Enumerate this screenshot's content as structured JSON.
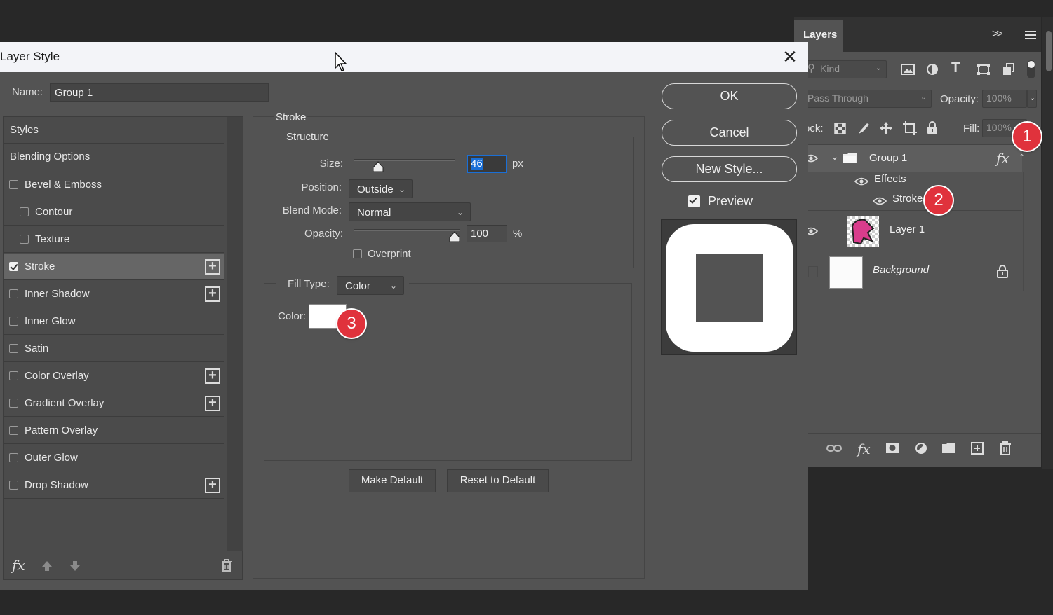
{
  "layers_panel": {
    "tab_label": "Layers",
    "expand_glyph": ">>",
    "filter_placeholder": "Kind",
    "blend_mode": "Pass Through",
    "opacity_label": "Opacity:",
    "opacity_value": "100%",
    "lock_label": "ock:",
    "fill_label": "Fill:",
    "fill_value": "100%",
    "layers": [
      {
        "name": "Group 1",
        "fx": "fx"
      },
      {
        "name": "Effects"
      },
      {
        "name": "Stroke"
      },
      {
        "name": "Layer 1"
      },
      {
        "name": "Background"
      }
    ]
  },
  "dialog": {
    "title": "Layer Style",
    "name_label": "Name:",
    "name_value": "Group 1",
    "styles": [
      {
        "label": "Styles",
        "checkbox": false,
        "plus": false
      },
      {
        "label": "Blending Options",
        "checkbox": false,
        "plus": false
      },
      {
        "label": "Bevel & Emboss",
        "checkbox": true,
        "checked": false,
        "plus": false
      },
      {
        "label": "Contour",
        "checkbox": true,
        "checked": false,
        "plus": false
      },
      {
        "label": "Texture",
        "checkbox": true,
        "checked": false,
        "plus": false
      },
      {
        "label": "Stroke",
        "checkbox": true,
        "checked": true,
        "plus": true
      },
      {
        "label": "Inner Shadow",
        "checkbox": true,
        "checked": false,
        "plus": true
      },
      {
        "label": "Inner Glow",
        "checkbox": true,
        "checked": false,
        "plus": false
      },
      {
        "label": "Satin",
        "checkbox": true,
        "checked": false,
        "plus": false
      },
      {
        "label": "Color Overlay",
        "checkbox": true,
        "checked": false,
        "plus": true
      },
      {
        "label": "Gradient Overlay",
        "checkbox": true,
        "checked": false,
        "plus": true
      },
      {
        "label": "Pattern Overlay",
        "checkbox": true,
        "checked": false,
        "plus": false
      },
      {
        "label": "Outer Glow",
        "checkbox": true,
        "checked": false,
        "plus": false
      },
      {
        "label": "Drop Shadow",
        "checkbox": true,
        "checked": false,
        "plus": true
      }
    ],
    "stroke": {
      "section_title": "Stroke",
      "structure_title": "Structure",
      "size_label": "Size:",
      "size_value": "46",
      "size_unit": "px",
      "position_label": "Position:",
      "position_value": "Outside",
      "blend_mode_label": "Blend Mode:",
      "blend_mode_value": "Normal",
      "opacity_label": "Opacity:",
      "opacity_value": "100",
      "opacity_unit": "%",
      "overprint_label": "Overprint",
      "fill_type_label": "Fill Type:",
      "fill_type_value": "Color",
      "color_label": "Color:",
      "color_value": "#ffffff"
    },
    "buttons": {
      "ok": "OK",
      "cancel": "Cancel",
      "new_style": "New Style...",
      "preview_label": "Preview",
      "make_default": "Make Default",
      "reset_default": "Reset to Default"
    },
    "footer_fx": "fx"
  },
  "badges": [
    "1",
    "2",
    "3"
  ],
  "colors": {
    "badge": "#e0323c",
    "selected_input": "#1a6fd6"
  }
}
